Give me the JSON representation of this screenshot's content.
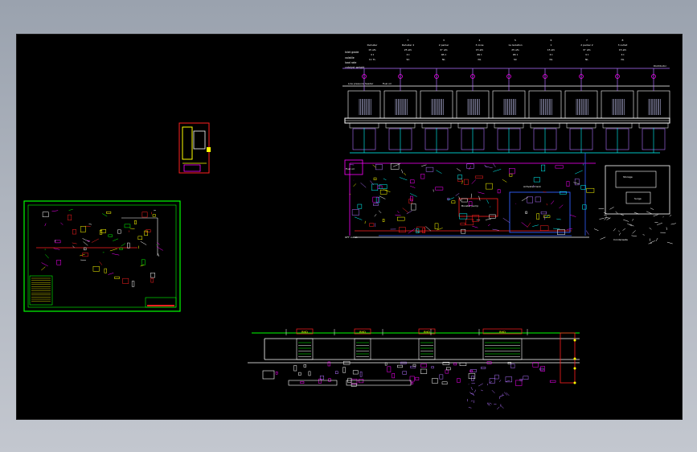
{
  "app": {
    "title": ""
  },
  "drawing": {
    "columns": [
      {
        "num": "",
        "name": "Dehuller",
        "l1": "15 afo",
        "l2": "3 t",
        "l3": "11 TL"
      },
      {
        "num": "7",
        "name": "Dehuller 2",
        "l1": "25 afo",
        "l2": "3 t",
        "l3": "SC"
      },
      {
        "num": "3",
        "name": "2 parker",
        "l1": "6° afo",
        "l2": "85 t",
        "l3": "NL"
      },
      {
        "num": "4",
        "name": "3 zone",
        "l1": "15 afo",
        "l2": "85 t",
        "l3": "NL"
      },
      {
        "num": "5",
        "name": "1a Isolation",
        "l1": "25 afo",
        "l2": "85 t",
        "l3": "SC"
      },
      {
        "num": "6",
        "name": "1",
        "l1": "15 afo",
        "l2": "3 t",
        "l3": "NL"
      },
      {
        "num": "7",
        "name": "2 parker 2",
        "l1": "6° afo",
        "l2": "3 t",
        "l3": "NL"
      },
      {
        "num": "8",
        "name": "3 outlet",
        "l1": "15 afo",
        "l2": "3 t",
        "l3": "NL"
      }
    ],
    "row_labels": [
      "Inlet grade",
      "volatile",
      "load rate",
      "catalyst weight"
    ],
    "labels": {
      "main_header": "Low pressure header",
      "alt_header": "Fuel oil",
      "right_top": "Distributor",
      "lower_left": "Fuel oil",
      "pump_station": "Booster pump",
      "tank_a": "Activated tank",
      "tank_b": "Storage",
      "tank_c": "Surge",
      "right_bottom": "Condensate",
      "footer": "OFF outlet",
      "bottom_tags": [
        "RHD",
        "RHD",
        "RHD",
        "RHD"
      ]
    }
  },
  "colors": {
    "background_page": "#aeb4be",
    "canvas": "#000000",
    "magenta": "#ff00ff",
    "purple": "#b070ff",
    "cyan": "#00ffff",
    "red": "#ff2020",
    "yellow": "#ffff00",
    "green": "#00ff00",
    "white": "#ffffff",
    "blue": "#3060ff",
    "orange": "#ff8000"
  }
}
